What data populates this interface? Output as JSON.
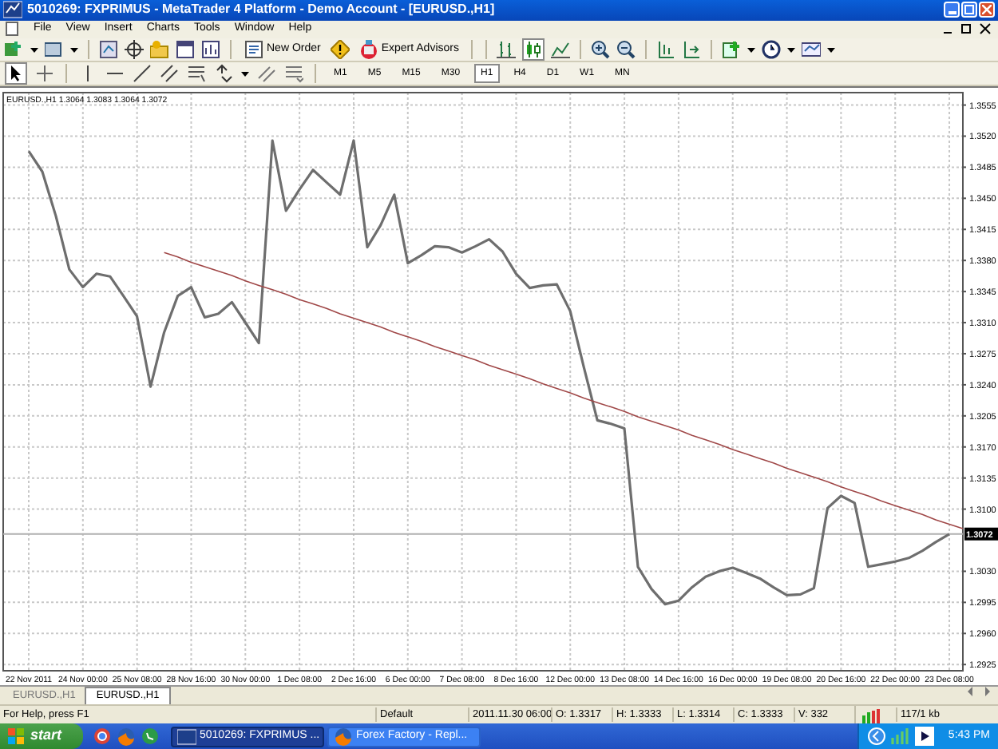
{
  "window": {
    "title": "5010269: FXPRIMUS - MetaTrader 4 Platform - Demo Account - [EURUSD.,H1]"
  },
  "menu": [
    "File",
    "View",
    "Insert",
    "Charts",
    "Tools",
    "Window",
    "Help"
  ],
  "toolbar": {
    "buttons": [
      "New Order",
      "Expert Advisors"
    ]
  },
  "timeframes": [
    {
      "label": "M1",
      "selected": false
    },
    {
      "label": "M5",
      "selected": false
    },
    {
      "label": "M15",
      "selected": false
    },
    {
      "label": "M30",
      "selected": false
    },
    {
      "label": "H1",
      "selected": true
    },
    {
      "label": "H4",
      "selected": false
    },
    {
      "label": "D1",
      "selected": false
    },
    {
      "label": "W1",
      "selected": false
    },
    {
      "label": "MN",
      "selected": false
    }
  ],
  "chart": {
    "chart_data": {
      "type": "line",
      "title": "EURUSD.,H1  1.3064 1.3083 1.3064 1.3072",
      "categories": [
        "22 Nov 2011",
        null,
        null,
        null,
        "24 Nov 00:00",
        null,
        null,
        null,
        "25 Nov 08:00",
        null,
        null,
        null,
        "28 Nov 16:00",
        null,
        null,
        null,
        "30 Nov 00:00",
        null,
        null,
        null,
        "1 Dec 08:00",
        null,
        null,
        null,
        "2 Dec 16:00",
        null,
        null,
        null,
        "6 Dec 00:00",
        null,
        null,
        null,
        "7 Dec 08:00",
        null,
        null,
        null,
        "8 Dec 16:00",
        null,
        null,
        null,
        "12 Dec 00:00",
        null,
        null,
        null,
        "13 Dec 08:00",
        null,
        null,
        null,
        "14 Dec 16:00",
        null,
        null,
        null,
        "16 Dec 00:00",
        null,
        null,
        null,
        "19 Dec 08:00",
        null,
        null,
        null,
        "20 Dec 16:00",
        null,
        null,
        null,
        "22 Dec 00:00",
        null,
        null,
        null,
        "23 Dec 08:00",
        null
      ],
      "series": [
        {
          "color": "#6e6e6e",
          "values": [
            1.3503,
            1.348,
            1.343,
            1.337,
            1.335,
            1.3365,
            1.3362,
            1.334,
            1.3317,
            1.3238,
            1.3299,
            1.334,
            1.335,
            1.3316,
            1.332,
            1.3333,
            1.331,
            1.3287,
            1.3515,
            1.3436,
            1.346,
            1.3482,
            1.3468,
            1.3454,
            1.3515,
            1.3395,
            1.342,
            1.3454,
            1.3377,
            1.3386,
            1.3396,
            1.3395,
            1.3389,
            1.3396,
            1.3404,
            1.339,
            1.3365,
            1.3349,
            1.3352,
            1.3353,
            1.3323,
            1.326,
            1.32,
            1.3196,
            1.3191,
            1.3035,
            1.301,
            1.2993,
            1.2997,
            1.3012,
            1.3024,
            1.303,
            1.3034,
            1.3028,
            1.3022,
            1.3012,
            1.3003,
            1.3004,
            1.3011,
            1.3101,
            1.3115,
            1.3107,
            1.3035,
            1.3038,
            1.3041,
            1.3045,
            1.3053,
            1.3063,
            1.3072,
            null
          ]
        },
        {
          "color": "#a04848",
          "values": [
            null,
            null,
            null,
            null,
            null,
            null,
            null,
            null,
            null,
            null,
            1.3389,
            1.3384,
            1.3378,
            1.3373,
            1.3368,
            1.3363,
            1.3357,
            1.3352,
            1.3347,
            1.3342,
            1.3336,
            1.3331,
            1.3326,
            1.332,
            1.3315,
            1.331,
            1.3305,
            1.3299,
            1.3294,
            1.3289,
            1.3283,
            1.3278,
            1.3273,
            1.3268,
            1.3262,
            1.3257,
            1.3252,
            1.3247,
            1.3241,
            1.3236,
            1.3231,
            1.3225,
            1.322,
            1.3215,
            1.321,
            1.3204,
            1.3199,
            1.3194,
            1.3189,
            1.3183,
            1.3178,
            1.3173,
            1.3167,
            1.3162,
            1.3157,
            1.3152,
            1.3146,
            1.3141,
            1.3136,
            1.3131,
            1.3125,
            1.312,
            1.3115,
            1.3109,
            1.3104,
            1.3099,
            1.3094,
            1.3088,
            1.3083,
            1.3078
          ]
        }
      ],
      "ylim": [
        1.2918,
        1.3569
      ],
      "grid": true,
      "yticks": [
        {
          "value": 1.3555,
          "label": "1.3555"
        },
        {
          "value": 1.352,
          "label": "1.3520"
        },
        {
          "value": 1.3485,
          "label": "1.3485"
        },
        {
          "value": 1.345,
          "label": "1.3450"
        },
        {
          "value": 1.3415,
          "label": "1.3415"
        },
        {
          "value": 1.338,
          "label": "1.3380"
        },
        {
          "value": 1.3345,
          "label": "1.3345"
        },
        {
          "value": 1.331,
          "label": "1.3310"
        },
        {
          "value": 1.3275,
          "label": "1.3275"
        },
        {
          "value": 1.324,
          "label": "1.3240"
        },
        {
          "value": 1.3205,
          "label": "1.3205"
        },
        {
          "value": 1.317,
          "label": "1.3170"
        },
        {
          "value": 1.3135,
          "label": "1.3135"
        },
        {
          "value": 1.31,
          "label": "1.3100"
        },
        {
          "value": 1.303,
          "label": "1.3030"
        },
        {
          "value": 1.2995,
          "label": "1.2995"
        },
        {
          "value": 1.296,
          "label": "1.2960"
        },
        {
          "value": 1.2925,
          "label": "1.2925"
        }
      ],
      "ref_lines": [
        {
          "axis": "y",
          "value": 1.3072,
          "label": "1.3072"
        }
      ]
    }
  },
  "chart_tabs": [
    {
      "label": "EURUSD.,H1",
      "selected": false
    },
    {
      "label": "EURUSD.,H1",
      "selected": true
    }
  ],
  "status_bar": {
    "help": "For Help, press F1",
    "profile": "Default",
    "time": "2011.11.30 06:00",
    "open": "O: 1.3317",
    "high": "H: 1.3333",
    "low": "L: 1.3314",
    "close": "C: 1.3333",
    "volume": "V: 332",
    "traffic": "117/1 kb"
  },
  "taskbar": {
    "start": "start",
    "tasks": [
      {
        "label": "5010269: FXPRIMUS ...",
        "selected": true
      },
      {
        "label": "Forex Factory - Repl...",
        "selected": false
      }
    ],
    "clock": "5:43 PM"
  }
}
